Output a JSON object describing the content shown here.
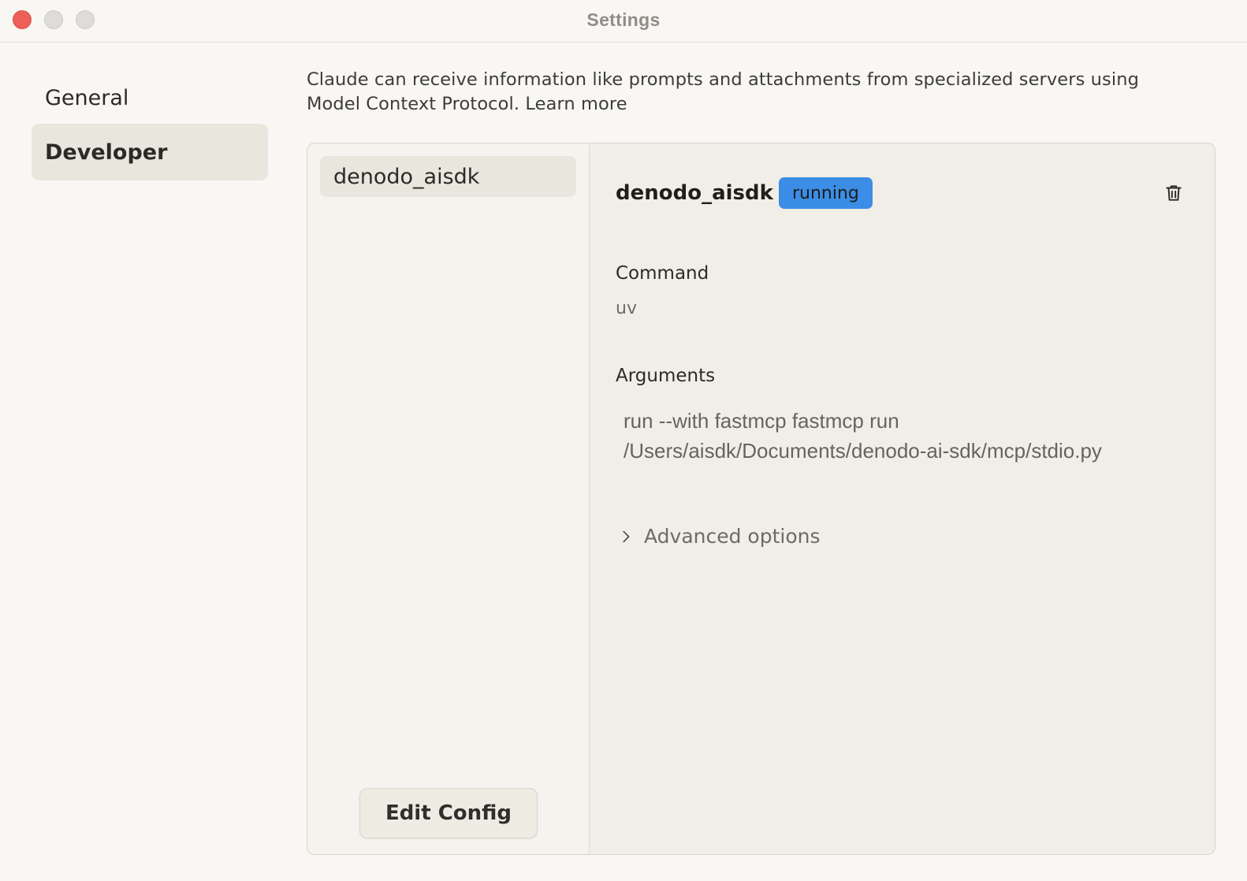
{
  "window": {
    "title": "Settings"
  },
  "sidebar": {
    "items": [
      {
        "label": "General"
      },
      {
        "label": "Developer"
      }
    ]
  },
  "intro": {
    "text": "Claude can receive information like prompts and attachments from specialized servers using Model Context Protocol.",
    "link": "Learn more"
  },
  "servers": {
    "items": [
      {
        "name": "denodo_aisdk"
      }
    ],
    "edit_config_label": "Edit Config"
  },
  "detail": {
    "title": "denodo_aisdk",
    "status": "running",
    "command_label": "Command",
    "command_value": "uv",
    "arguments_label": "Arguments",
    "arguments_line1": "run --with fastmcp fastmcp run",
    "arguments_line2": "/Users/aisdk/Documents/denodo-ai-sdk/mcp/stdio.py",
    "advanced_label": "Advanced options"
  },
  "colors": {
    "status_badge": "#3b8de5",
    "close_button": "#ee5f57"
  },
  "icons": {
    "delete": "trash-icon",
    "expand": "chevron-right-icon"
  }
}
